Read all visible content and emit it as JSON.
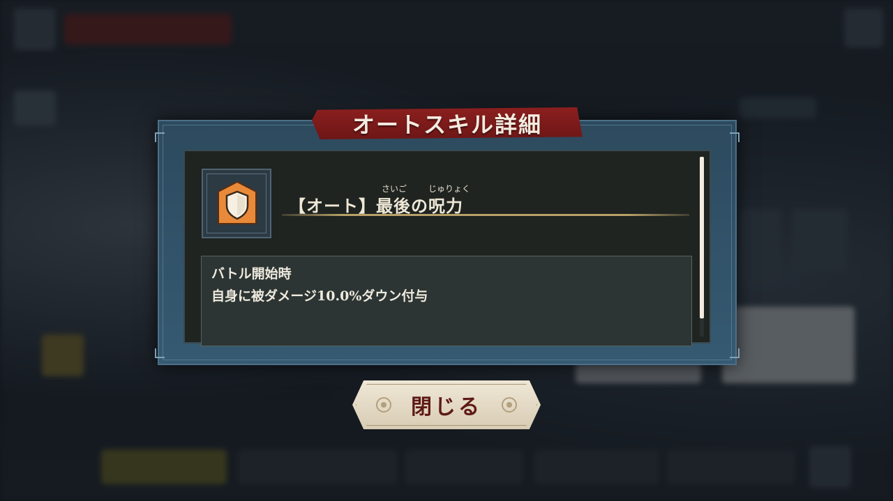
{
  "dialog": {
    "title": "オートスキル詳細",
    "skill": {
      "icon": "shield-icon",
      "name": "【オート】最後の呪力",
      "ruby": [
        {
          "target": "最後",
          "reading": "さいご"
        },
        {
          "target": "呪力",
          "reading": "じゅりょく"
        }
      ]
    },
    "description": {
      "lines": [
        "バトル開始時",
        "自身に被ダメージ10.0%ダウン付与"
      ]
    },
    "scroll_fraction": 0.9,
    "close_label": "閉じる"
  },
  "colors": {
    "title_banner": "#8c1f1f",
    "icon_orange": "#e98a3a",
    "close_text": "#5e1a16",
    "frame_blue": "#2d4a5e"
  }
}
